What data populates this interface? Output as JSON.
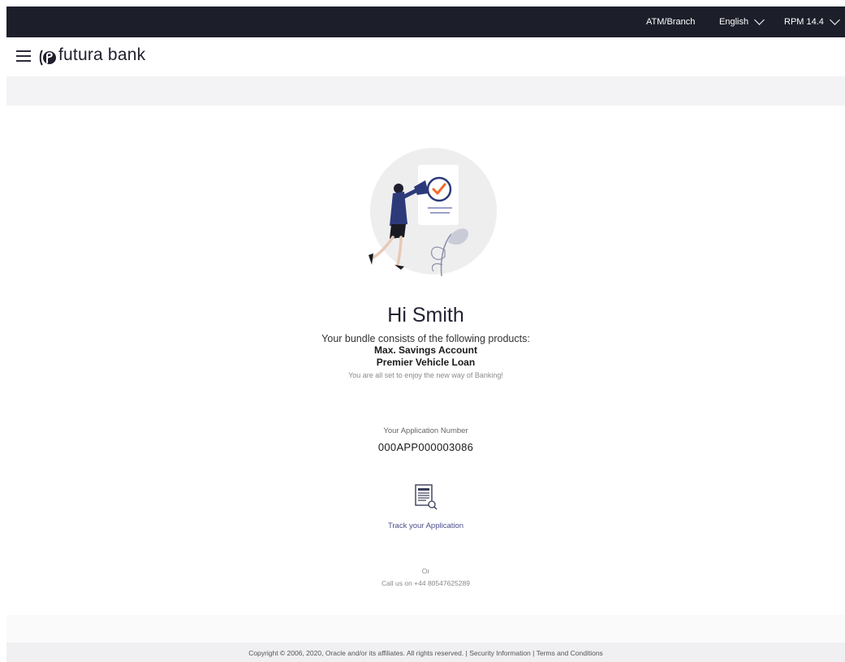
{
  "topbar": {
    "atm_branch": "ATM/Branch",
    "language": "English",
    "version": "RPM 14.4"
  },
  "header": {
    "brand": "futura bank"
  },
  "main": {
    "greeting": "Hi Smith",
    "lead": "Your bundle consists of the following products:",
    "products": [
      "Max. Savings Account",
      "Premier Vehicle Loan"
    ],
    "tagline": "You are all set to enjoy the new way of Banking!",
    "application_label": "Your Application Number",
    "application_number": "000APP000003086",
    "track_label": "Track your Application",
    "or_label": "Or",
    "call_label": "Call us on +44 80547625289"
  },
  "footer": {
    "copyright": "Copyright © 2006, 2020, Oracle and/or its affiliates. All rights reserved.",
    "separator": "|",
    "security": "Security Information",
    "terms": "Terms and Conditions"
  },
  "colors": {
    "topbar_bg": "#1c1f2a",
    "accent_orange": "#f26b2e",
    "figure_navy": "#2d3a7a",
    "link_blue": "#4a4f8a"
  },
  "icons": [
    "hamburger-menu-icon",
    "futura-logo-icon",
    "chevron-down-icon",
    "document-search-icon"
  ]
}
